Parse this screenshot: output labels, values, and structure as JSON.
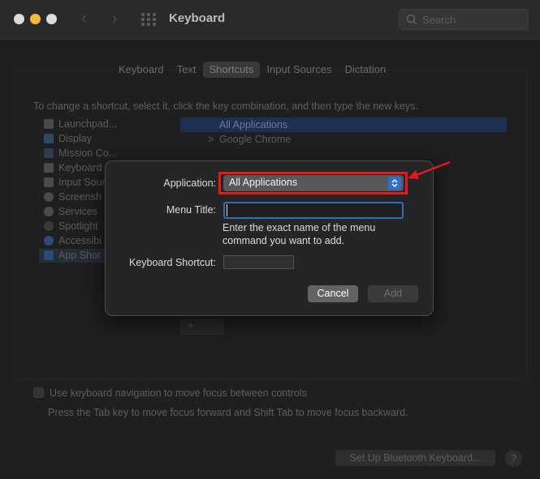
{
  "window": {
    "title": "Keyboard"
  },
  "search": {
    "placeholder": "Search"
  },
  "tabs": [
    {
      "label": "Keyboard"
    },
    {
      "label": "Text"
    },
    {
      "label": "Shortcuts",
      "active": true
    },
    {
      "label": "Input Sources"
    },
    {
      "label": "Dictation"
    }
  ],
  "instructions": "To change a shortcut, select it, click the key combination, and then type the new keys.",
  "categories": [
    {
      "label": "Launchpad..."
    },
    {
      "label": "Display"
    },
    {
      "label": "Mission Co..."
    },
    {
      "label": "Keyboard"
    },
    {
      "label": "Input Sour"
    },
    {
      "label": "Screensh"
    },
    {
      "label": "Services"
    },
    {
      "label": "Spotlight"
    },
    {
      "label": "Accessibi"
    },
    {
      "label": "App Shor"
    }
  ],
  "rules": [
    {
      "label": "All Applications",
      "selected": true
    },
    {
      "label": "Google Chrome",
      "chevron": ">"
    }
  ],
  "plus_label": "+",
  "keyboard_nav": {
    "checkbox_label": "Use keyboard navigation to move focus between controls",
    "sub_text": "Press the Tab key to move focus forward and Shift Tab to move focus backward."
  },
  "bottom": {
    "bluetooth_button": "Set Up Bluetooth Keyboard...",
    "help_button": "?"
  },
  "dialog": {
    "application_label": "Application:",
    "application_value": "All Applications",
    "menu_title_label": "Menu Title:",
    "menu_title_value": "",
    "hint_line1": "Enter the exact name of the menu",
    "hint_line2": "command you want to add.",
    "shortcut_label": "Keyboard Shortcut:",
    "cancel_label": "Cancel",
    "add_label": "Add"
  },
  "colors": {
    "annotation_red": "#e01b1b",
    "accent_blue": "#2f6fd6",
    "window_bg": "#1f1f21"
  }
}
